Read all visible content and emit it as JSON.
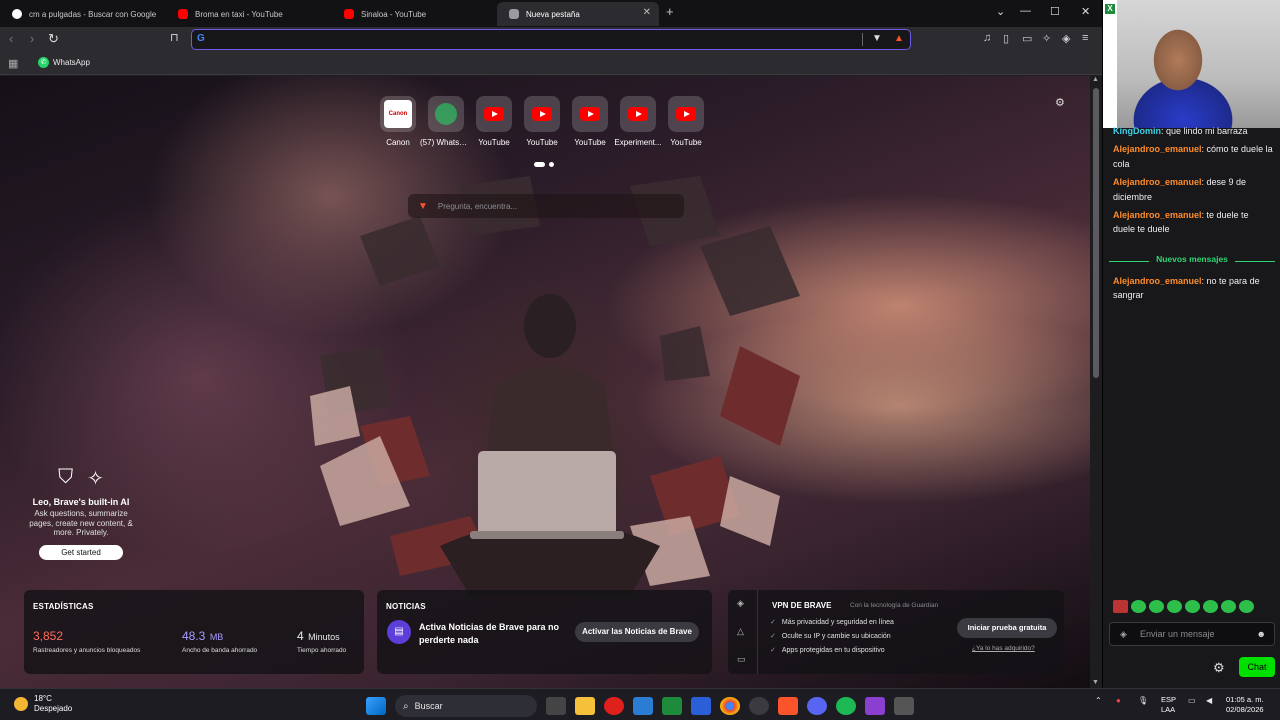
{
  "tabs": [
    {
      "title": "cm a pulgadas - Buscar con Google",
      "color": "#4285f4"
    },
    {
      "title": "Broma en taxi - YouTube",
      "color": "#ff0000"
    },
    {
      "title": "Sinaloa - YouTube",
      "color": "#ff0000"
    },
    {
      "title": "Nueva pestaña",
      "color": "#9a9aa0"
    }
  ],
  "toolbar": {
    "omnibox_value": ""
  },
  "bookmarks": [
    {
      "label": "WhatsApp"
    }
  ],
  "shortcuts": [
    {
      "label": "Canon",
      "icon": "canon-icon"
    },
    {
      "label": "(57) WhatsApp",
      "icon": "whatsapp-icon"
    },
    {
      "label": "YouTube",
      "icon": "youtube-icon"
    },
    {
      "label": "YouTube",
      "icon": "youtube-icon"
    },
    {
      "label": "YouTube",
      "icon": "youtube-icon"
    },
    {
      "label": "Experiment...",
      "icon": "youtube-icon"
    },
    {
      "label": "YouTube",
      "icon": "youtube-icon"
    }
  ],
  "search": {
    "placeholder": "Pregunta, encuentra..."
  },
  "leo": {
    "title": "Leo, Brave's built-in AI",
    "description": "Ask questions, summarize pages, create new content, & more. Privately.",
    "cta": "Get started"
  },
  "stats": {
    "heading": "ESTADÍSTICAS",
    "trackers": {
      "value": "3,852",
      "label": "Rastreadores y anuncios bloqueados",
      "color": "#ff6b5b"
    },
    "bandwidth": {
      "value": "48.3",
      "unit": "MB",
      "label": "Ancho de banda ahorrado",
      "color": "#a79bff"
    },
    "time": {
      "value": "4",
      "unit": "Minutos",
      "label": "Tiempo ahorrado",
      "color": "#ffffff"
    }
  },
  "news": {
    "heading": "NOTICIAS",
    "text": "Activa Noticias de Brave para no perderte nada",
    "button": "Activar las Noticias de Brave"
  },
  "vpn": {
    "title": "VPN DE BRAVE",
    "tech": "Con la tecnología de  Guardian",
    "features": [
      "Más privacidad y seguridad en línea",
      "Oculte su IP y cambie su ubicación",
      "Apps protegidas en tu dispositivo"
    ],
    "button": "Iniciar prueba gratuita",
    "link": "¿Ya lo has adquirido?"
  },
  "chat": {
    "partial_message": {
      "user": "KingDomin",
      "text": ": que lindo mi barraza"
    },
    "messages_before": [
      {
        "user": "Alejandroo_emanuel",
        "text": ": cómo te duele la cola"
      },
      {
        "user": "Alejandroo_emanuel",
        "text": ": dese 9 de diciembre"
      },
      {
        "user": "Alejandroo_emanuel",
        "text": ": te duele te duele te duele"
      }
    ],
    "new_messages_label": "Nuevos mensajes",
    "messages_after": [
      {
        "user": "Alejandroo_emanuel",
        "text": ": no te para de sangrar"
      }
    ],
    "user_color": "#ff8c2a",
    "partial_user_color": "#3fd0e8",
    "input_placeholder": "Enviar un mensaje",
    "chat_button": "Chat"
  },
  "taskbar": {
    "temperature": "18°C",
    "weather": "Despejado",
    "search_label": "Buscar",
    "lang_line1": "ESP",
    "lang_line2": "LAA",
    "time": "01:05 a. m.",
    "date": "02/08/2026"
  }
}
